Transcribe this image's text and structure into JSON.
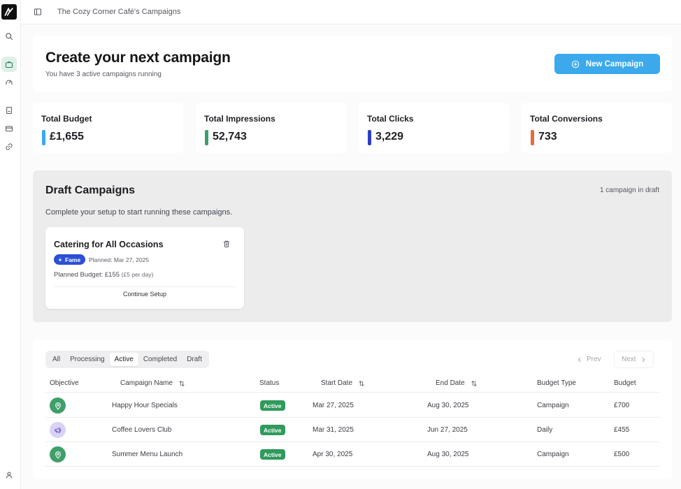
{
  "topbar": {
    "title": "The Cozy Corner Café's Campaigns"
  },
  "hero": {
    "title": "Create your next campaign",
    "subtitle": "You have 3 active campaigns running",
    "new_button_label": "New Campaign"
  },
  "stats": [
    {
      "label": "Total Budget",
      "value": "£1,655",
      "color": "#3ba9ec"
    },
    {
      "label": "Total Impressions",
      "value": "52,743",
      "color": "#3f9f6a"
    },
    {
      "label": "Total Clicks",
      "value": "3,229",
      "color": "#2d3fc9"
    },
    {
      "label": "Total Conversions",
      "value": "733",
      "color": "#e76a3c"
    }
  ],
  "draft": {
    "title": "Draft Campaigns",
    "count": "1 campaign in draft",
    "description": "Complete your setup to start running these campaigns.",
    "card": {
      "name": "Catering for All Occasions",
      "badge": "Fame",
      "planned": "Planned: Mar 27, 2025",
      "budget": "Planned Budget: £155",
      "budget_note": "(£5 per day)",
      "continue_label": "Continue Setup"
    }
  },
  "campaigns": {
    "tabs": [
      "All",
      "Processing",
      "Active",
      "Completed",
      "Draft"
    ],
    "active_tab": "Active",
    "prev_label": "Prev",
    "next_label": "Next",
    "columns": [
      "Objective",
      "Campaign Name",
      "Status",
      "Start Date",
      "End Date",
      "Budget Type",
      "Budget"
    ],
    "rows": [
      {
        "objective_icon": "map-pin-icon",
        "name": "Happy Hour Specials",
        "status": "Active",
        "start": "Mar 27, 2025",
        "end": "Aug 30, 2025",
        "budget_type": "Campaign",
        "budget": "£700"
      },
      {
        "objective_icon": "megaphone-icon",
        "name": "Coffee Lovers Club",
        "status": "Active",
        "start": "Mar 31, 2025",
        "end": "Jun 27, 2025",
        "budget_type": "Daily",
        "budget": "£455"
      },
      {
        "objective_icon": "map-pin-icon",
        "name": "Summer Menu Launch",
        "status": "Active",
        "start": "Apr 30, 2025",
        "end": "Aug 30, 2025",
        "budget_type": "Campaign",
        "budget": "£500"
      }
    ]
  },
  "colors": {
    "accent": "#3ba9ec",
    "status_active": "#2f9a5c",
    "badge_fame": "#2b4fd6"
  }
}
